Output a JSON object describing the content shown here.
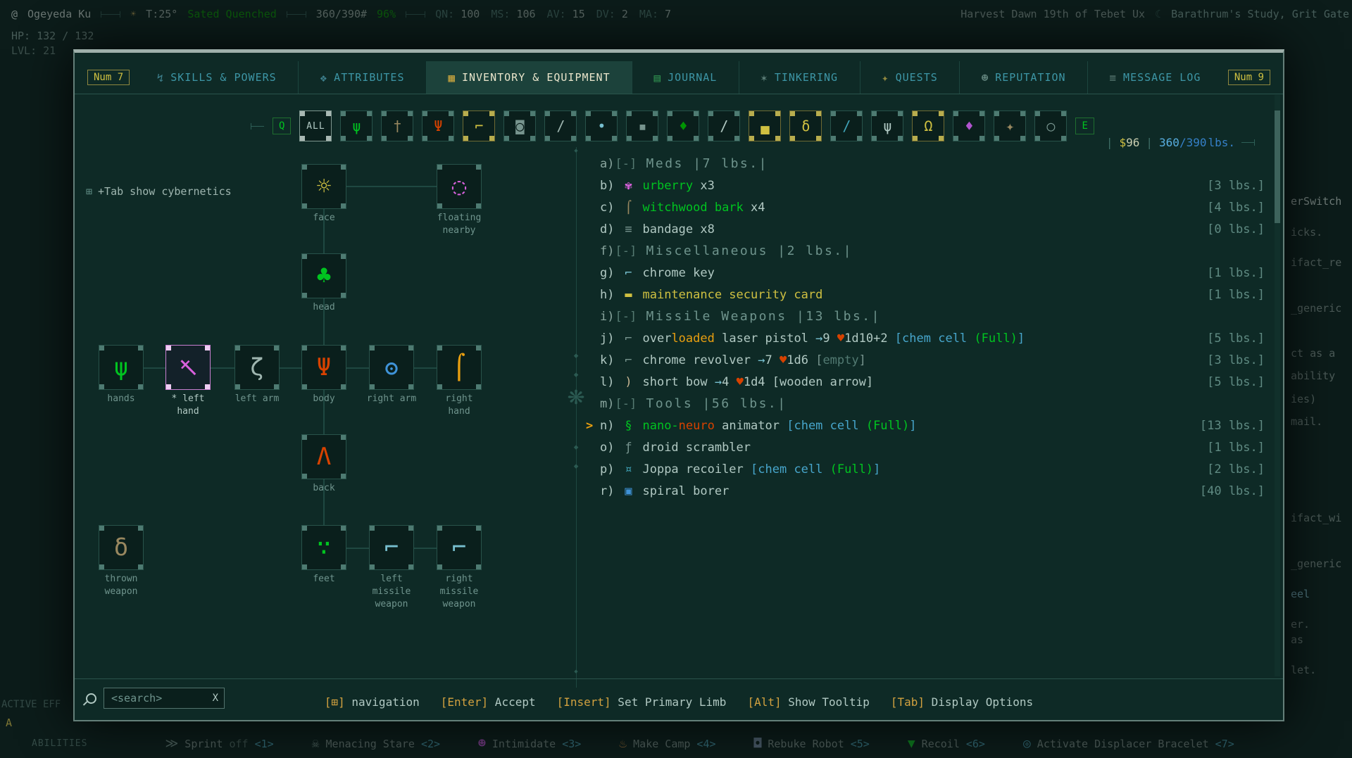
{
  "colors": {
    "wh": "#b1c9c3",
    "bw": "#c8b693",
    "gy": "#77948e",
    "dgy": "#527a72",
    "wt": "#5f8a82",
    "cy": "#40a4b9",
    "bcy": "#77bfcf",
    "cc": "#47a6cc",
    "bl": "#3f93d8",
    "gr": "#00c420",
    "dgr": "#009403",
    "ye": "#cfc041",
    "or": "#e99f10",
    "rd": "#d74200",
    "mg": "#d961dd",
    "br": "#98875f"
  },
  "hud": {
    "player_glyph": "@",
    "player_name": "Ogeyeda Ku",
    "temperature": "T:25°",
    "status": "Sated Quenched",
    "weight": "360/390#",
    "percent": "96%",
    "stats": [
      [
        "QN:",
        "100"
      ],
      [
        "MS:",
        "106"
      ],
      [
        "AV:",
        "15"
      ],
      [
        "DV:",
        "2"
      ],
      [
        "MA:",
        "7"
      ]
    ],
    "date": "Harvest Dawn 19th of Tebet Ux",
    "moon_glyph": "☾",
    "location": "Barathrum's Study, Grit Gate",
    "hp": "HP: 132 / 132",
    "level": "LVL: 21",
    "active_effects_label": "ACTIVE EFF",
    "effect_badge": "A",
    "abilities_label": "ABILITIES",
    "abilities": [
      {
        "name": "Sprint",
        "state": "off",
        "hotkey": "<1>",
        "icon": {
          "name": "sprint-icon",
          "glyph": "≫",
          "color": "#6f948d"
        }
      },
      {
        "name": "Menacing Stare",
        "hotkey": "<2>",
        "icon": {
          "name": "menacing-stare-icon",
          "glyph": "☠",
          "color": "#6f948d"
        }
      },
      {
        "name": "Intimidate",
        "hotkey": "<3>",
        "icon": {
          "name": "intimidate-icon",
          "glyph": "☻",
          "color": "#b154cf"
        }
      },
      {
        "name": "Make Camp",
        "hotkey": "<4>",
        "icon": {
          "name": "make-camp-icon",
          "glyph": "♨",
          "color": "#cf8f3f"
        }
      },
      {
        "name": "Rebuke Robot",
        "hotkey": "<5>",
        "icon": {
          "name": "rebuke-robot-icon",
          "glyph": "◘",
          "color": "#6f8fa8"
        }
      },
      {
        "name": "Recoil",
        "hotkey": "<6>",
        "icon": {
          "name": "recoil-icon",
          "glyph": "▼",
          "color": "#00c420"
        }
      },
      {
        "name": "Activate Displacer Bracelet",
        "hotkey": "<7>",
        "icon": {
          "name": "displacer-bracelet-icon",
          "glyph": "◎",
          "color": "#40a4b9"
        }
      }
    ],
    "right_fragments": [
      "erSwitch",
      "icks.",
      "ifact_re",
      "_generic",
      "ct as a",
      "ability",
      "ies)",
      "mail.",
      "ifact_wi",
      "_generic",
      "eel",
      "er.",
      "as",
      "let."
    ]
  },
  "tabs": {
    "left_badge": "Num 7",
    "right_badge": "Num 9",
    "items": [
      {
        "label": "SKILLS & POWERS",
        "icon": {
          "name": "skills-icon",
          "glyph": "↯",
          "color": "#3d7f8c"
        }
      },
      {
        "label": "ATTRIBUTES",
        "icon": {
          "name": "attributes-icon",
          "glyph": "❖",
          "color": "#3d7f8c"
        }
      },
      {
        "label": "INVENTORY & EQUIPMENT",
        "active": true,
        "icon": {
          "name": "inventory-icon",
          "glyph": "▦",
          "color": "#c9a53f"
        }
      },
      {
        "label": "JOURNAL",
        "icon": {
          "name": "journal-icon",
          "glyph": "▤",
          "color": "#2f8f4f"
        }
      },
      {
        "label": "TINKERING",
        "icon": {
          "name": "tinkering-icon",
          "glyph": "✶",
          "color": "#5d7f78"
        }
      },
      {
        "label": "QUESTS",
        "icon": {
          "name": "quests-icon",
          "glyph": "✦",
          "color": "#8f873f"
        }
      },
      {
        "label": "REPUTATION",
        "icon": {
          "name": "reputation-icon",
          "glyph": "☻",
          "color": "#5d7f78"
        }
      },
      {
        "label": "MESSAGE LOG",
        "icon": {
          "name": "message-log-icon",
          "glyph": "≡",
          "color": "#5d7f78"
        }
      }
    ]
  },
  "filters": {
    "left_key": "Q",
    "right_key": "E",
    "all_label": "ALL",
    "sep": "|",
    "money_symbol": "$",
    "money_value": "96",
    "weight_current": "360",
    "weight_rest": "/390",
    "weight_unit": "lbs.",
    "icons": [
      {
        "name": "filter-corpses-icon",
        "glyph": "ψ",
        "color": "#00c420"
      },
      {
        "name": "filter-melee-weapons-icon",
        "glyph": "†",
        "color": "#98875f"
      },
      {
        "name": "filter-armor-icon",
        "glyph": "Ψ",
        "color": "#d74200"
      },
      {
        "name": "filter-missile-weapons-icon",
        "glyph": "⌐",
        "color": "#cfc041",
        "highlight": true
      },
      {
        "name": "filter-shields-icon",
        "glyph": "◙",
        "color": "#77948e"
      },
      {
        "name": "filter-tools-icon",
        "glyph": "/",
        "color": "#9fb6b0"
      },
      {
        "name": "filter-ammo-icon",
        "glyph": "•",
        "color": "#77bfcf"
      },
      {
        "name": "filter-projectiles-icon",
        "glyph": "▪",
        "color": "#77948e"
      },
      {
        "name": "filter-food-icon",
        "glyph": "♦",
        "color": "#009403"
      },
      {
        "name": "filter-light-sources-icon",
        "glyph": "/",
        "color": "#b1c9c3"
      },
      {
        "name": "filter-energy-cells-icon",
        "glyph": "▄",
        "color": "#cfc041",
        "highlight": true
      },
      {
        "name": "filter-tonics-icon",
        "glyph": "δ",
        "color": "#cfc041",
        "highlight": true
      },
      {
        "name": "filter-wands-icon",
        "glyph": "/",
        "color": "#40a4b9"
      },
      {
        "name": "filter-creatures-icon",
        "glyph": "ψ",
        "color": "#b1c9c3"
      },
      {
        "name": "filter-figurines-icon",
        "glyph": "Ω",
        "color": "#cfc041",
        "highlight": true
      },
      {
        "name": "filter-gems-icon",
        "glyph": "♦",
        "color": "#b154cf"
      },
      {
        "name": "filter-trade-goods-icon",
        "glyph": "✦",
        "color": "#98875f"
      },
      {
        "name": "filter-miscellaneous-icon",
        "glyph": "○",
        "color": "#77948e"
      }
    ]
  },
  "equipment": {
    "cybernetics_hint": {
      "glyph": "⊞",
      "text": "+Tab show cybernetics"
    },
    "slots": [
      {
        "name": "slot-face",
        "label": "face",
        "glyph": "☼",
        "color": "#cfc041"
      },
      {
        "name": "slot-floating-nearby",
        "label": "floating\nnearby",
        "glyph": "◌",
        "color": "#d961dd"
      },
      {
        "name": "slot-head",
        "label": "head",
        "glyph": "♣",
        "color": "#00c420"
      },
      {
        "name": "slot-hands",
        "label": "hands",
        "glyph": "ψ",
        "color": "#00c420"
      },
      {
        "name": "slot-left-hand",
        "label": "* left\nhand",
        "glyph": "†",
        "color": "#d961dd",
        "selected": true
      },
      {
        "name": "slot-left-arm",
        "label": "left arm",
        "glyph": "ζ",
        "color": "#9fb6b0"
      },
      {
        "name": "slot-body",
        "label": "body",
        "glyph": "Ψ",
        "color": "#d74200"
      },
      {
        "name": "slot-right-arm",
        "label": "right arm",
        "glyph": "ʘ",
        "color": "#3f93d8"
      },
      {
        "name": "slot-right-hand",
        "label": "right\nhand",
        "glyph": "⌠",
        "color": "#e99f10"
      },
      {
        "name": "slot-back",
        "label": "back",
        "glyph": "Λ",
        "color": "#d74200"
      },
      {
        "name": "slot-thrown-weapon",
        "label": "thrown\nweapon",
        "glyph": "δ",
        "color": "#98875f"
      },
      {
        "name": "slot-feet",
        "label": "feet",
        "glyph": "∵",
        "color": "#00c420"
      },
      {
        "name": "slot-left-missile-weapon",
        "label": "left\nmissile\nweapon",
        "glyph": "⌐",
        "color": "#77bfcf"
      },
      {
        "name": "slot-right-missile-weapon",
        "label": "right\nmissile\nweapon",
        "glyph": "⌐",
        "color": "#77bfcf"
      }
    ]
  },
  "inventory": {
    "cursor": ">",
    "rows": [
      {
        "type": "category",
        "letter": "a)",
        "collapse": "[-]",
        "title": "Meds",
        "inline_weight": "|7 lbs.|"
      },
      {
        "type": "item",
        "letter": "b)",
        "icon": {
          "name": "urberry-icon",
          "glyph": "✾",
          "color": "mg"
        },
        "parts": [
          {
            "t": "urberry",
            "c": "gr"
          },
          {
            "t": " x3",
            "c": "wh"
          }
        ],
        "weight": "[3 lbs.]"
      },
      {
        "type": "item",
        "letter": "c)",
        "icon": {
          "name": "witchwood-bark-icon",
          "glyph": "⌠",
          "color": "br"
        },
        "parts": [
          {
            "t": "witchwood bark",
            "c": "gr"
          },
          {
            "t": " x4",
            "c": "wh"
          }
        ],
        "weight": "[4 lbs.]"
      },
      {
        "type": "item",
        "letter": "d)",
        "icon": {
          "name": "bandage-icon",
          "glyph": "≡",
          "color": "gy"
        },
        "parts": [
          {
            "t": "bandage",
            "c": "wh"
          },
          {
            "t": " x8",
            "c": "wh"
          }
        ],
        "weight": "[0 lbs.]"
      },
      {
        "type": "category",
        "letter": "f)",
        "collapse": "[-]",
        "title": "Miscellaneous",
        "inline_weight": "|2 lbs.|"
      },
      {
        "type": "item",
        "letter": "g)",
        "icon": {
          "name": "chrome-key-icon",
          "glyph": "⌐",
          "color": "bcy"
        },
        "parts": [
          {
            "t": "chrome key",
            "c": "wh"
          }
        ],
        "weight": "[1 lbs.]"
      },
      {
        "type": "item",
        "letter": "h)",
        "icon": {
          "name": "security-card-icon",
          "glyph": "▬",
          "color": "ye"
        },
        "parts": [
          {
            "t": "maintenance security card",
            "c": "ye"
          }
        ],
        "weight": "[1 lbs.]"
      },
      {
        "type": "category",
        "letter": "i)",
        "collapse": "[-]",
        "title": "Missile Weapons",
        "inline_weight": "|13 lbs.|"
      },
      {
        "type": "item",
        "letter": "j)",
        "icon": {
          "name": "laser-pistol-icon",
          "glyph": "⌐",
          "color": "gy"
        },
        "parts": [
          {
            "t": "over",
            "c": "wh"
          },
          {
            "t": "loaded",
            "c": "or"
          },
          {
            "t": " laser pistol ",
            "c": "wh"
          },
          {
            "t": "→",
            "c": "bcy"
          },
          {
            "t": "9 ",
            "c": "wh"
          },
          {
            "t": "♥",
            "c": "rd"
          },
          {
            "t": "1d10+2 ",
            "c": "wh"
          },
          {
            "t": "[",
            "c": "cc"
          },
          {
            "t": "chem cell ",
            "c": "cc"
          },
          {
            "t": "(Full)",
            "c": "gr"
          },
          {
            "t": "]",
            "c": "cc"
          }
        ],
        "weight": "[5 lbs.]"
      },
      {
        "type": "item",
        "letter": "k)",
        "icon": {
          "name": "chrome-revolver-icon",
          "glyph": "⌐",
          "color": "gy"
        },
        "parts": [
          {
            "t": "chrome revolver ",
            "c": "wh"
          },
          {
            "t": "→",
            "c": "bcy"
          },
          {
            "t": "7 ",
            "c": "wh"
          },
          {
            "t": "♥",
            "c": "rd"
          },
          {
            "t": "1d6 ",
            "c": "wh"
          },
          {
            "t": "[",
            "c": "gy"
          },
          {
            "t": "empty",
            "c": "dgy"
          },
          {
            "t": "]",
            "c": "gy"
          }
        ],
        "weight": "[3 lbs.]"
      },
      {
        "type": "item",
        "letter": "l)",
        "icon": {
          "name": "short-bow-icon",
          "glyph": ")",
          "color": "bw"
        },
        "parts": [
          {
            "t": "short bow ",
            "c": "wh"
          },
          {
            "t": "→",
            "c": "bcy"
          },
          {
            "t": "4 ",
            "c": "wh"
          },
          {
            "t": "♥",
            "c": "rd"
          },
          {
            "t": "1d4 ",
            "c": "wh"
          },
          {
            "t": "[wooden arrow]",
            "c": "wh"
          }
        ],
        "weight": "[5 lbs.]"
      },
      {
        "type": "category",
        "letter": "m)",
        "collapse": "[-]",
        "title": "Tools",
        "inline_weight": "|56 lbs.|"
      },
      {
        "type": "item",
        "letter": "n)",
        "selected": true,
        "icon": {
          "name": "nano-neuro-animator-icon",
          "glyph": "§",
          "color": "gr"
        },
        "parts": [
          {
            "t": "nano-",
            "c": "gr"
          },
          {
            "t": "neuro",
            "c": "rd"
          },
          {
            "t": " animator ",
            "c": "wh"
          },
          {
            "t": "[",
            "c": "cc"
          },
          {
            "t": "chem cell ",
            "c": "cc"
          },
          {
            "t": "(Full)",
            "c": "gr"
          },
          {
            "t": "]",
            "c": "cc"
          }
        ],
        "weight": "[13 lbs.]"
      },
      {
        "type": "item",
        "letter": "o)",
        "icon": {
          "name": "droid-scrambler-icon",
          "glyph": "ƒ",
          "color": "gy"
        },
        "parts": [
          {
            "t": "droid scrambler",
            "c": "wh"
          }
        ],
        "weight": "[1 lbs.]"
      },
      {
        "type": "item",
        "letter": "p)",
        "icon": {
          "name": "joppa-recoiler-icon",
          "glyph": "¤",
          "color": "cy"
        },
        "parts": [
          {
            "t": "Joppa recoiler ",
            "c": "wh"
          },
          {
            "t": "[",
            "c": "cc"
          },
          {
            "t": "chem cell ",
            "c": "cc"
          },
          {
            "t": "(Full)",
            "c": "gr"
          },
          {
            "t": "]",
            "c": "cc"
          }
        ],
        "weight": "[2 lbs.]"
      },
      {
        "type": "item",
        "letter": "r)",
        "icon": {
          "name": "spiral-borer-icon",
          "glyph": "▣",
          "color": "bl"
        },
        "parts": [
          {
            "t": "spiral borer",
            "c": "wh"
          }
        ],
        "weight": "[40 lbs.]"
      }
    ]
  },
  "footer": {
    "search_placeholder": "<search>",
    "clear_label": "X",
    "hints": [
      {
        "key": "⊞",
        "label": "navigation",
        "is_icon": true
      },
      {
        "key": "Enter",
        "label": "Accept"
      },
      {
        "key": "Insert",
        "label": "Set Primary Limb"
      },
      {
        "key": "Alt",
        "label": "Show Tooltip"
      },
      {
        "key": "Tab",
        "label": "Display Options"
      }
    ]
  }
}
